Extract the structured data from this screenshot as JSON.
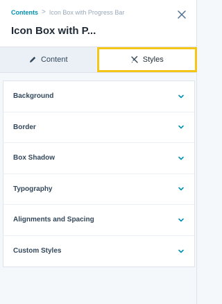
{
  "breadcrumb": {
    "root": "Contents",
    "separator": ">",
    "current": "Icon Box with Progress Bar"
  },
  "title": "Icon Box with P...",
  "tabs": [
    {
      "label": "Content",
      "icon": "pencil-icon"
    },
    {
      "label": "Styles",
      "icon": "styles-icon",
      "active": true
    }
  ],
  "sections": [
    {
      "label": "Background"
    },
    {
      "label": "Border"
    },
    {
      "label": "Box Shadow"
    },
    {
      "label": "Typography"
    },
    {
      "label": "Alignments and Spacing"
    },
    {
      "label": "Custom Styles"
    }
  ],
  "colors": {
    "accent": "#0091ae",
    "highlight": "#f5c518"
  }
}
